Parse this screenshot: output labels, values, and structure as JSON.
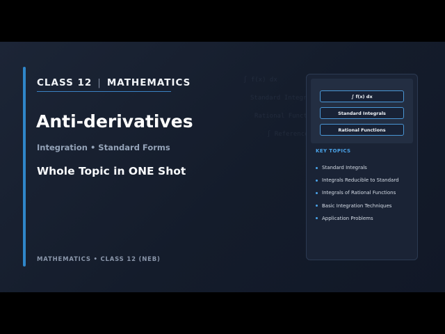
{
  "header": {
    "class_label": "CLASS 12",
    "separator": "|",
    "subject": "MATHEMATICS"
  },
  "title": "Anti-derivatives",
  "subtitle": "Integration • Standard Forms",
  "tagline": "Whole Topic in ONE Shot",
  "footer": "MATHEMATICS • CLASS 12 (NEB)",
  "card": {
    "buttons": [
      "∫ f(x) dx",
      "Standard Integrals",
      "Rational Functions"
    ],
    "topics_title": "KEY TOPICS",
    "topics": [
      "Standard Integrals",
      "Integrals Reducible to Standard",
      "Integrals of Rational Functions",
      "Basic Integration Techniques",
      "Application Problems"
    ]
  },
  "colors": {
    "accent": "#2f86c9",
    "topic_accent": "#4aa3e8",
    "background": "#161e2d"
  }
}
